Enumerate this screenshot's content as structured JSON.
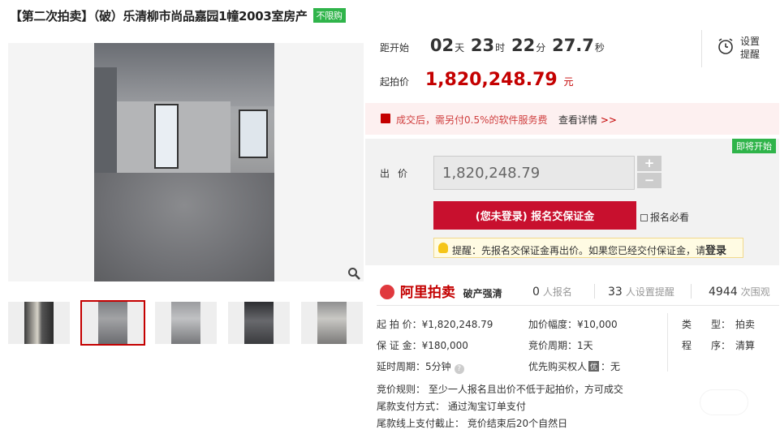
{
  "title": {
    "text": "【第二次拍卖】（破）乐清柳市尚品嘉园1幢2003室房产",
    "badge": "不限购"
  },
  "countdown": {
    "label": "距开始",
    "days": "02",
    "days_unit": "天",
    "hours": "23",
    "hours_unit": "时",
    "minutes": "22",
    "minutes_unit": "分",
    "seconds": "27.7",
    "seconds_unit": "秒"
  },
  "start_price": {
    "label": "起拍价",
    "value": "1,820,248.79",
    "unit": "元"
  },
  "reminder": {
    "label_line1": "设置",
    "label_line2": "提醒"
  },
  "notice": {
    "text": "成交后，需另付0.5%的软件服务费",
    "link": "查看详情",
    "link_arrow": ">>"
  },
  "bid": {
    "status_badge": "即将开始",
    "label": "出价",
    "value": "1,820,248.79",
    "plus": "+",
    "minus": "−",
    "signup_button": "(您未登录) 报名交保证金",
    "must_read": "报名必看",
    "tip_text": "提醒：先报名交保证金再出价。如果您已经交付保证金，请",
    "tip_login": "登录"
  },
  "brand": {
    "name": "阿里拍卖",
    "sub": "破产强清"
  },
  "stats": [
    {
      "value": "0",
      "label": "人报名"
    },
    {
      "value": "33",
      "label": "人设置提醒"
    },
    {
      "value": "4944",
      "label": "次围观"
    }
  ],
  "details": {
    "start_price": "起 拍 价：¥1,820,248.79",
    "deposit": "保 证 金：¥180,000",
    "delay": "延时周期：5分钟",
    "increment": "加价幅度：¥10,000",
    "cycle": "竞价周期：1天",
    "priority_label": "优先购买权人",
    "priority_badge": "优",
    "priority_value": "：无",
    "type": "类　　型：　拍卖",
    "procedure": "程　　序：　清算"
  },
  "rules": {
    "rule": "竞价规则： 至少一人报名且出价不低于起拍价，方可成交",
    "payment": "尾款支付方式： 通过淘宝订单支付",
    "deadline": "尾款线上支付截止： 竞价结束后20个自然日"
  },
  "colors": {
    "accent_red": "#c40000",
    "button_red": "#c8102e",
    "green_badge": "#2fb44a"
  },
  "icons": [
    "zoom-icon",
    "alarm-clock-icon",
    "gift-icon",
    "bulb-icon",
    "book-icon",
    "help-icon",
    "alibaba-logo"
  ]
}
